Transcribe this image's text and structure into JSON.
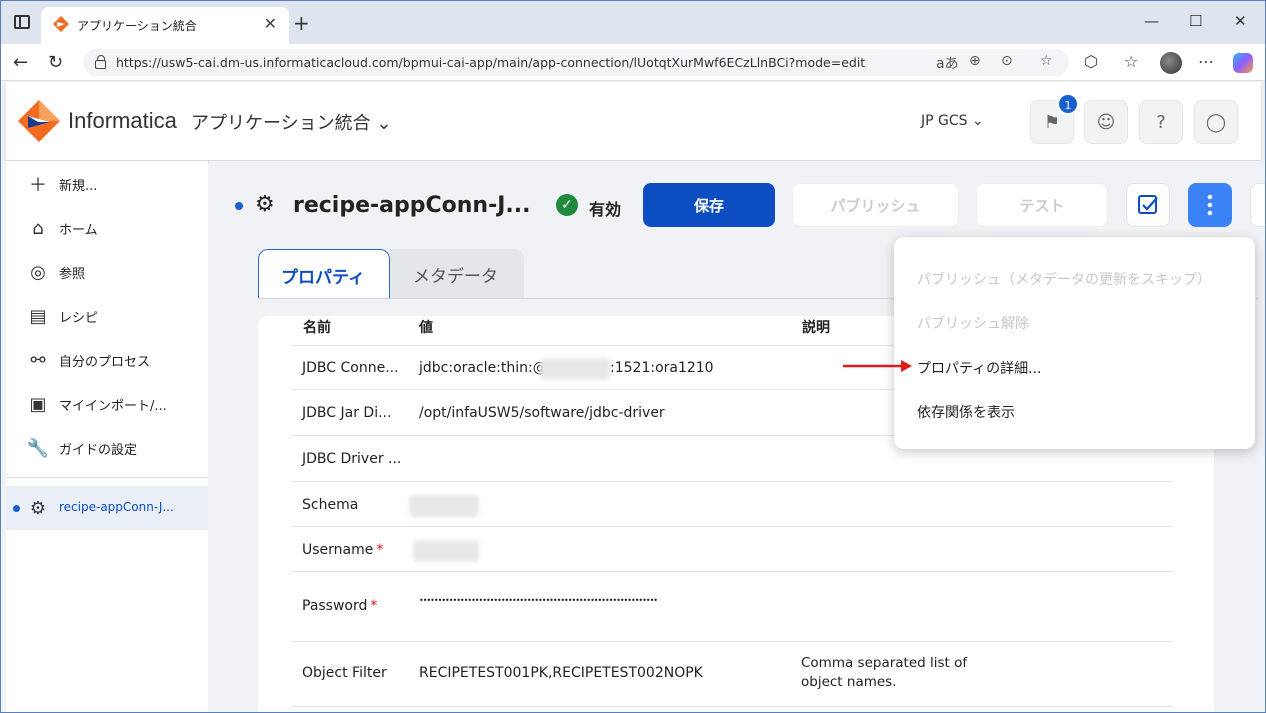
{
  "browser": {
    "tab_title": "アプリケーション統合",
    "tab_close": "✕",
    "new_tab": "+",
    "url": "https://usw5-cai.dm-us.informaticacloud.com/bpmui-cai-app/main/app-connection/lUotqtXurMwf6ECzLlnBCi?mode=edit",
    "controls": {
      "minimize": "—",
      "maximize": "☐",
      "close": "✕"
    }
  },
  "header": {
    "brand": "Informatica",
    "app_name": "アプリケーション統合 ⌄",
    "org": "JP GCS ⌄",
    "notification_count": "1"
  },
  "sidebar": {
    "items": [
      {
        "label": "新規...",
        "icon": "plus-icon"
      },
      {
        "label": "ホーム",
        "icon": "home-icon"
      },
      {
        "label": "参照",
        "icon": "compass-icon"
      },
      {
        "label": "レシピ",
        "icon": "recipe-icon"
      },
      {
        "label": "自分のプロセス",
        "icon": "process-icon"
      },
      {
        "label": "マイインポート/...",
        "icon": "import-icon"
      },
      {
        "label": "ガイドの設定",
        "icon": "wrench-icon"
      }
    ],
    "open_item": "recipe-appConn-J..."
  },
  "main": {
    "title": "recipe-appConn-J...",
    "status": "有効",
    "buttons": {
      "save": "保存",
      "publish": "パブリッシュ",
      "test": "テスト"
    },
    "tabs": [
      {
        "label": "プロパティ",
        "active": true
      },
      {
        "label": "メタデータ",
        "active": false
      }
    ],
    "table": {
      "headers": {
        "name": "名前",
        "value": "値",
        "description": "説明"
      },
      "rows": [
        {
          "name": "JDBC Conne...",
          "value_prefix": "jdbc:oracle:thin:@",
          "value_suffix": ":1521:ora1210",
          "description": ""
        },
        {
          "name": "JDBC Jar Di...",
          "value": "/opt/infaUSW5/software/jdbc-driver",
          "description": ""
        },
        {
          "name": "JDBC Driver ...",
          "value": "",
          "description": ""
        },
        {
          "name": "Schema",
          "value": "",
          "description": ""
        },
        {
          "name": "Username",
          "required": true,
          "value": "",
          "description": ""
        },
        {
          "name": "Password",
          "required": true,
          "value": "••••••••••••••••••••••••••••••••••••••••••••••••••••••••••••••••",
          "description": ""
        },
        {
          "name": "Object Filter",
          "value": "RECIPETEST001PK,RECIPETEST002NOPK",
          "description": "Comma separated list of object names."
        }
      ]
    }
  },
  "menu": {
    "items": [
      {
        "label": "パブリッシュ（メタデータの更新をスキップ）",
        "enabled": false
      },
      {
        "label": "パブリッシュ解除",
        "enabled": false
      },
      {
        "label": "プロパティの詳細...",
        "enabled": true
      },
      {
        "label": "依存関係を表示",
        "enabled": true
      }
    ]
  },
  "colors": {
    "primary": "#0c4dc2",
    "active_status": "#1f8a3e",
    "arrow": "#e01b1b",
    "required": "#dd1111"
  }
}
